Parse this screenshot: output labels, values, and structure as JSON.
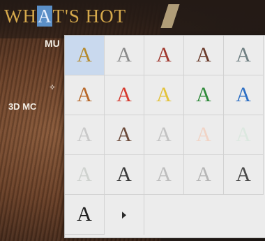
{
  "background": {
    "headline_before": "WH",
    "headline_highlight": "A",
    "headline_after": "T'S HOT",
    "side_line_1": "MU",
    "side_glyph": "✧",
    "side_line_2": "3D MC"
  },
  "palette": {
    "styles": [
      {
        "glyph": "A",
        "color": "#b58a2e",
        "selected": true
      },
      {
        "glyph": "A",
        "color": "#8a8a8a"
      },
      {
        "glyph": "A",
        "color": "#a0362c"
      },
      {
        "glyph": "A",
        "color": "#6a3a2a"
      },
      {
        "glyph": "A",
        "color": "#6f7f82"
      },
      {
        "glyph": "A",
        "color": "#b8682a"
      },
      {
        "glyph": "A",
        "color": "#d63a2e"
      },
      {
        "glyph": "A",
        "color": "#e3c23a"
      },
      {
        "glyph": "A",
        "color": "#2f8a3a"
      },
      {
        "glyph": "A",
        "color": "#2d6fc4"
      },
      {
        "glyph": "A",
        "color": "#c9c9c9"
      },
      {
        "glyph": "A",
        "color": "#6b4a3a"
      },
      {
        "glyph": "A",
        "color": "#c2c2c2"
      },
      {
        "glyph": "A",
        "color": "#f1d4c6"
      },
      {
        "glyph": "A",
        "color": "#dce8e0"
      },
      {
        "glyph": "A",
        "color": "#cfd2cf"
      },
      {
        "glyph": "A",
        "color": "#3a3a3a"
      },
      {
        "glyph": "A",
        "color": "#bdbdbd"
      },
      {
        "glyph": "A",
        "color": "#b6b6b6"
      },
      {
        "glyph": "A",
        "color": "#4a4a4a"
      },
      {
        "glyph": "A",
        "color": "#222222"
      }
    ],
    "more_icon": "triangle-right-icon"
  }
}
